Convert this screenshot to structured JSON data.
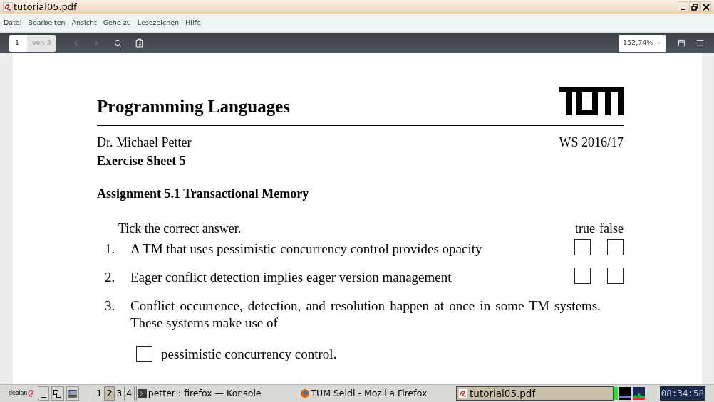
{
  "window": {
    "title": "tutorial05.pdf"
  },
  "menu": [
    "Datei",
    "Bearbeiten",
    "Ansicht",
    "Gehe zu",
    "Lesezeichen",
    "Hilfe"
  ],
  "toolbar": {
    "page": "1",
    "page_count": "von 3",
    "zoom": "152,74%"
  },
  "document": {
    "heading": "Programming Languages",
    "author": "Dr. Michael Petter",
    "term": "WS 2016/17",
    "sheet": "Exercise Sheet 5",
    "assignment": "Assignment 5.1 Transactional Memory",
    "instruction": "Tick the correct answer.",
    "answer_headers": [
      "true",
      "false"
    ],
    "questions": [
      {
        "number": "1.",
        "text": "A TM that uses pessimistic concurrency control provides opacity",
        "answers": [
          {
            "checked": false
          },
          {
            "checked": false
          }
        ]
      },
      {
        "number": "2.",
        "text": "Eager conflict detection implies eager version management",
        "answers": [
          {
            "checked": false
          },
          {
            "checked": false
          }
        ]
      },
      {
        "number": "3.",
        "text": "Conflict occurrence, detection, and resolution happen at once in some TM systems. These systems make use of"
      }
    ],
    "options": [
      {
        "label": "pessimistic concurrency control.",
        "checked": false
      }
    ]
  },
  "taskbar": {
    "start_label": "debian",
    "workspaces": [
      {
        "label": "1",
        "selected": false
      },
      {
        "label": "2",
        "selected": true
      },
      {
        "label": "3",
        "selected": false
      },
      {
        "label": "4",
        "selected": false
      }
    ],
    "tasks": [
      {
        "kind": "terminal",
        "label": "petter : firefox — Konsole",
        "selected": false
      },
      {
        "kind": "browser",
        "label": "TUM Seidl - Mozilla Firefox",
        "selected": false
      },
      {
        "kind": "pdf",
        "label": "tutorial05.pdf",
        "selected": true
      }
    ],
    "clock": "08:34:58"
  }
}
